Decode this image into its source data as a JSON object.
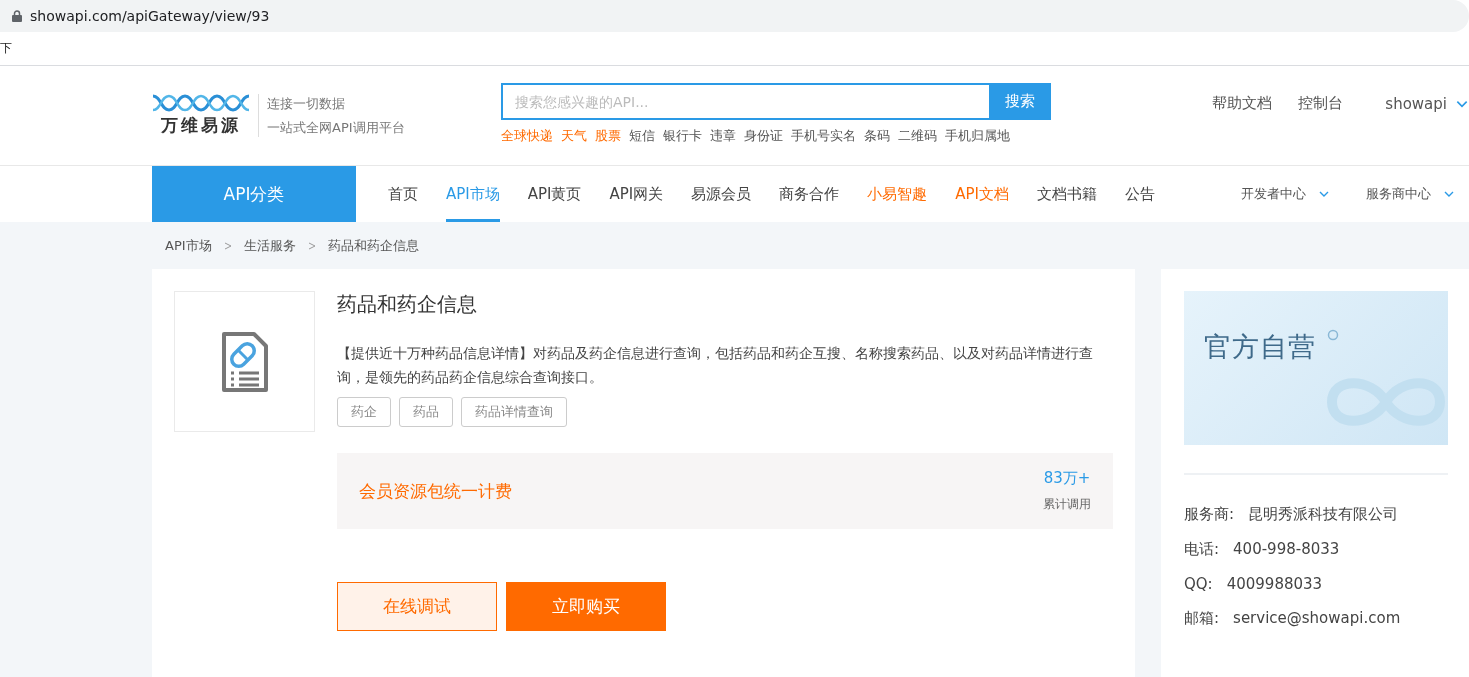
{
  "browser": {
    "address": "showapi.com/apiGateway/view/93",
    "bookmark": "下"
  },
  "header": {
    "logo_name": "万维易源",
    "slogan_lines": [
      "连接一切数据",
      "一站式全网API调用平台"
    ],
    "search": {
      "placeholder": "搜索您感兴趣的API...",
      "button": "搜索"
    },
    "hot_tags": [
      {
        "label": "全球快递",
        "hot": true
      },
      {
        "label": "天气",
        "hot": true
      },
      {
        "label": "股票",
        "hot": true
      },
      {
        "label": "短信",
        "hot": false
      },
      {
        "label": "银行卡",
        "hot": false
      },
      {
        "label": "违章",
        "hot": false
      },
      {
        "label": "身份证",
        "hot": false
      },
      {
        "label": "手机号实名",
        "hot": false
      },
      {
        "label": "条码",
        "hot": false
      },
      {
        "label": "二维码",
        "hot": false
      },
      {
        "label": "手机归属地",
        "hot": false
      }
    ],
    "links": [
      "帮助文档",
      "控制台"
    ],
    "user": "showapi"
  },
  "nav": {
    "category": "API分类",
    "items": [
      {
        "label": "首页",
        "selected": false,
        "hot": false
      },
      {
        "label": "API市场",
        "selected": true,
        "hot": false
      },
      {
        "label": "API黄页",
        "selected": false,
        "hot": false
      },
      {
        "label": "API网关",
        "selected": false,
        "hot": false
      },
      {
        "label": "易源会员",
        "selected": false,
        "hot": false
      },
      {
        "label": "商务合作",
        "selected": false,
        "hot": false
      },
      {
        "label": "小易智趣",
        "selected": false,
        "hot": true
      },
      {
        "label": "API文档",
        "selected": false,
        "hot": true
      },
      {
        "label": "文档书籍",
        "selected": false,
        "hot": false
      },
      {
        "label": "公告",
        "selected": false,
        "hot": false
      }
    ],
    "menus": [
      "开发者中心",
      "服务商中心"
    ]
  },
  "breadcrumb": [
    "API市场",
    "生活服务",
    "药品和药企信息"
  ],
  "product": {
    "title": "药品和药企信息",
    "description": "【提供近十万种药品信息详情】对药品及药企信息进行查询，包括药品和药企互搜、名称搜索药品、以及对药品详情进行查询，是领先的药品药企信息综合查询接口。",
    "tags": [
      "药企",
      "药品",
      "药品详情查询"
    ],
    "pricing": {
      "plan": "会员资源包统一计费",
      "calls": "83万+",
      "calls_label": "累计调用"
    },
    "buttons": [
      {
        "label": "在线调试",
        "kind": "secondary"
      },
      {
        "label": "立即购买",
        "kind": "primary"
      }
    ]
  },
  "provider": {
    "banner": "官方自营",
    "info": [
      {
        "label": "服务商:",
        "value": "昆明秀派科技有限公司"
      },
      {
        "label": "电话:",
        "value": "400-998-8033"
      },
      {
        "label": "QQ:",
        "value": "4009988033"
      },
      {
        "label": "邮箱:",
        "value": "service@showapi.com"
      }
    ]
  }
}
